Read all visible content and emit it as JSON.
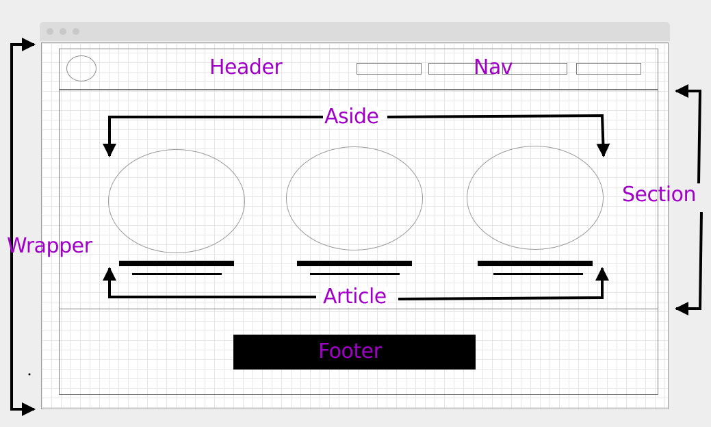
{
  "diagram": {
    "labels": {
      "header": "Header",
      "nav": "Nav",
      "aside": "Aside",
      "section": "Section",
      "wrapper": "Wrapper",
      "article": "Article",
      "footer": "Footer"
    },
    "label_color": "#a100c8",
    "nav_button_count": 4,
    "card_count": 3
  }
}
